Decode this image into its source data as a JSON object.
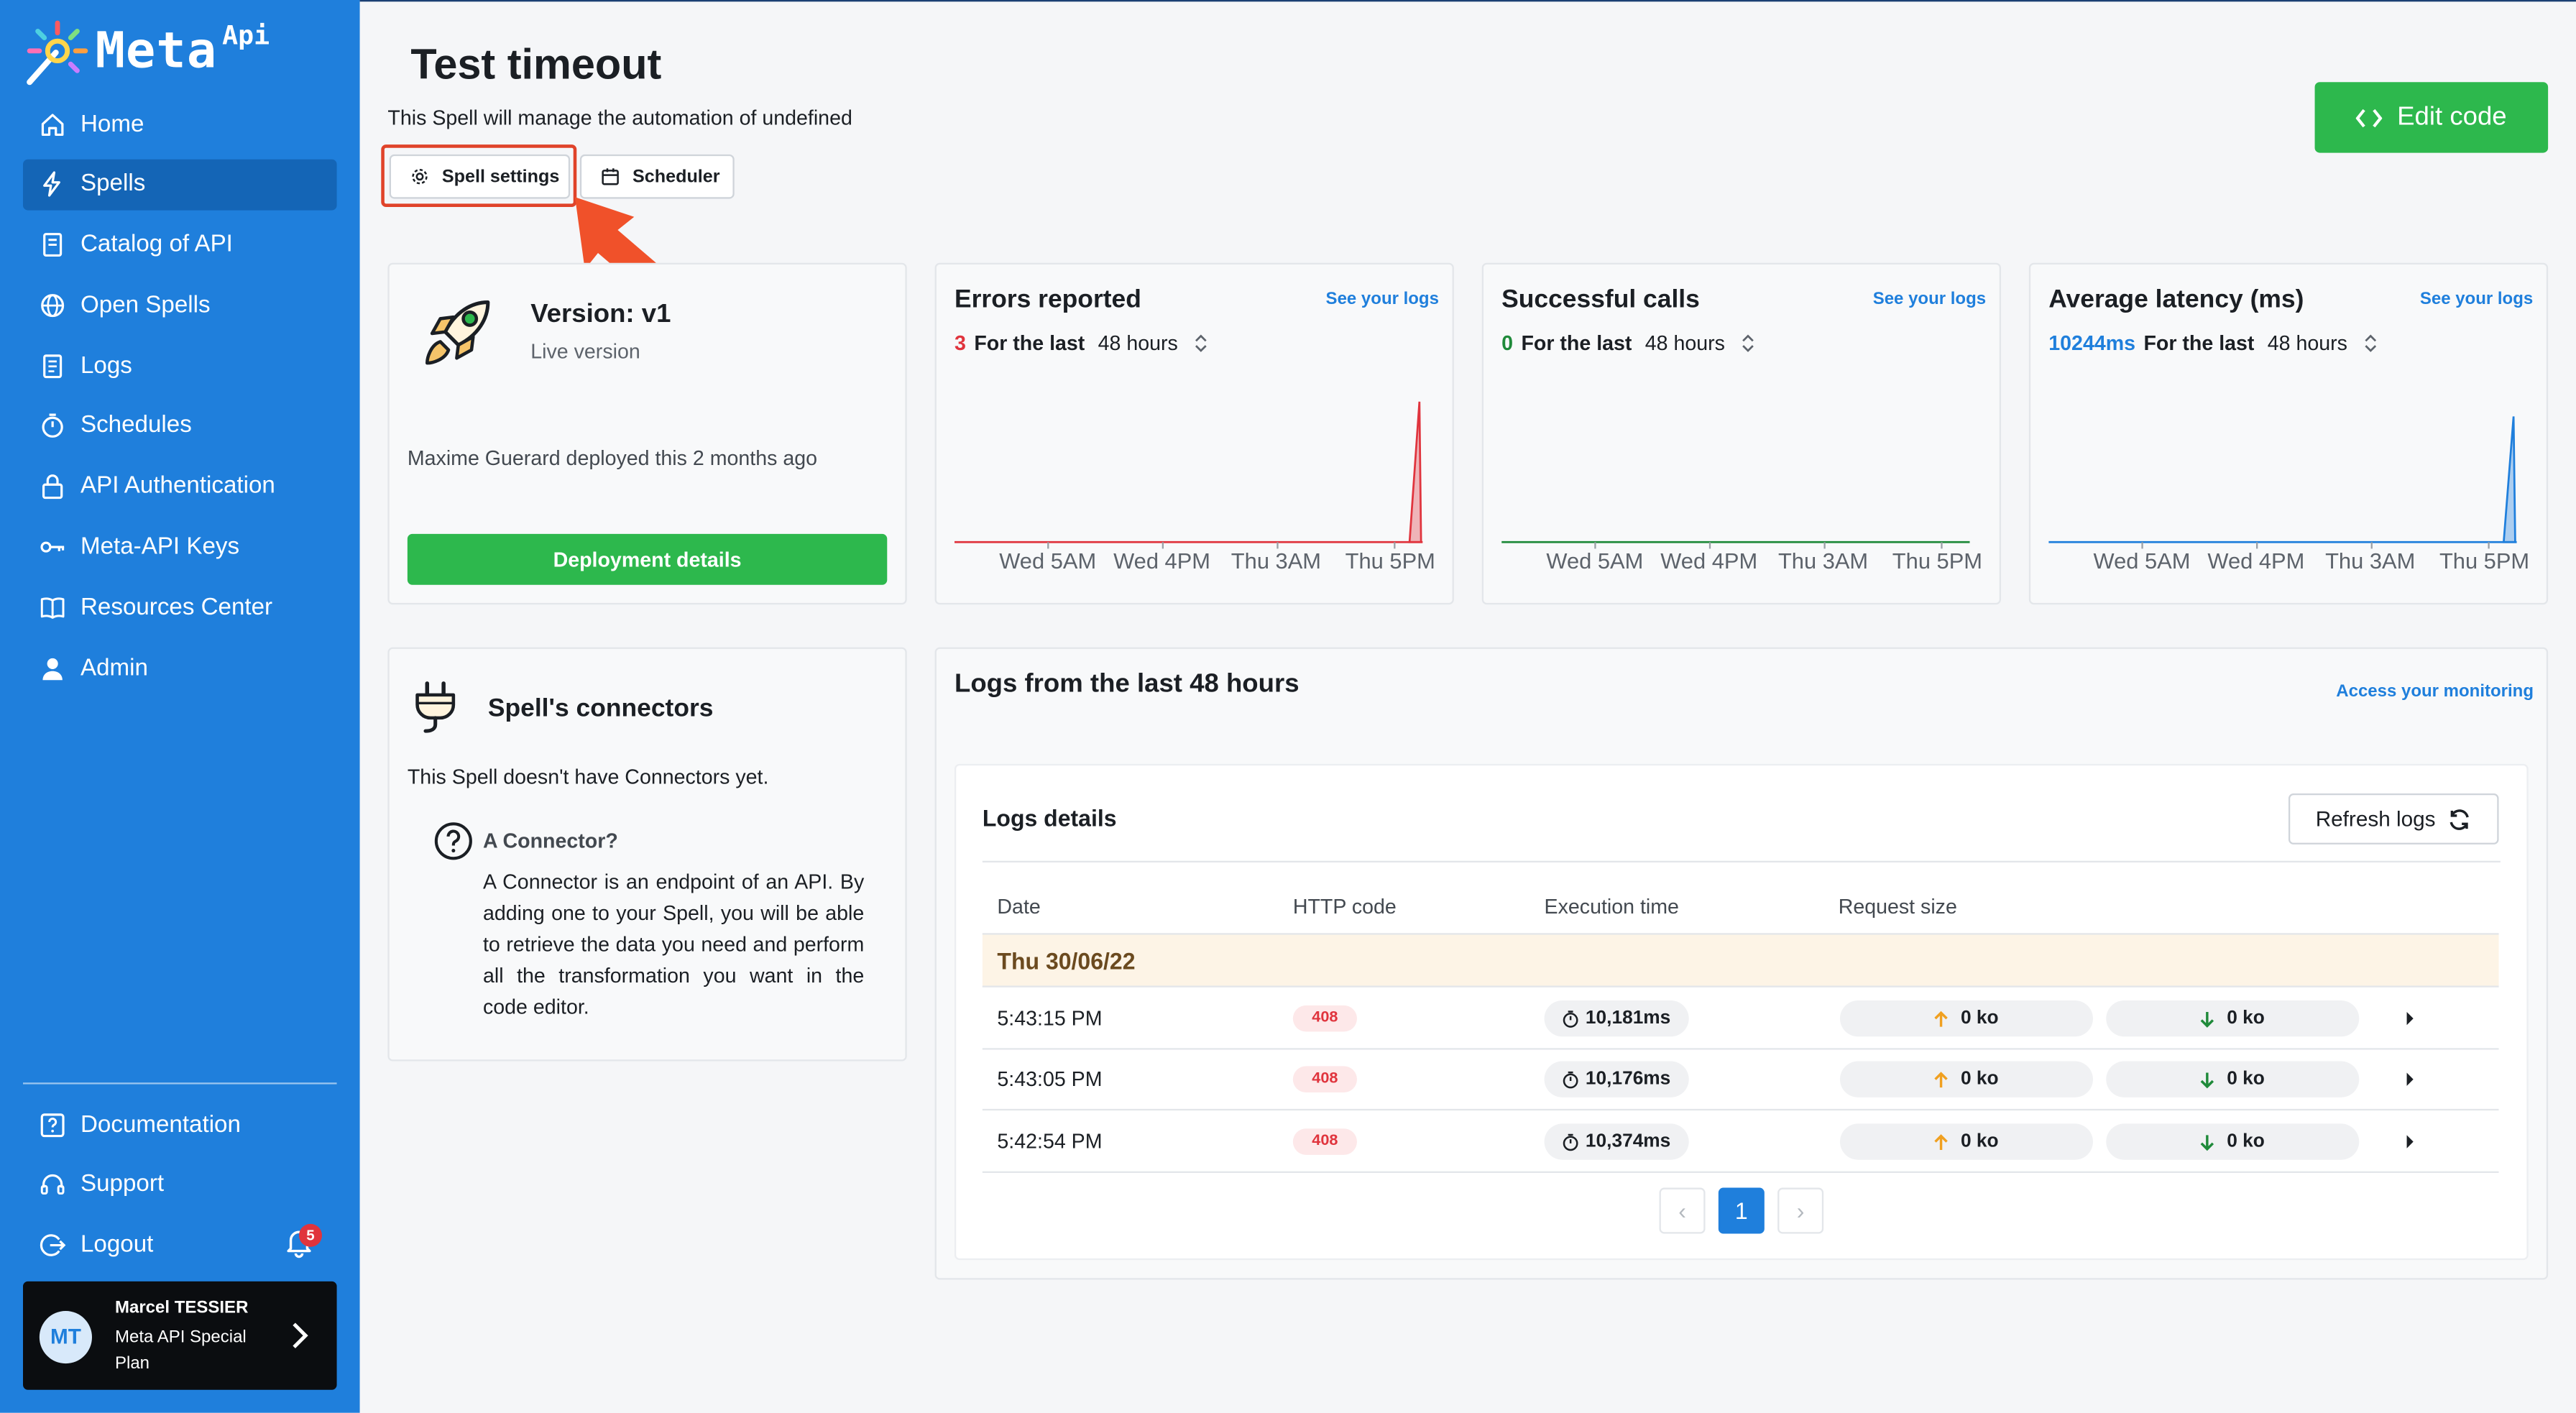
{
  "brand": {
    "name": "Meta",
    "sup": "Api"
  },
  "sidebar": {
    "items": [
      {
        "label": "Home",
        "icon": "home-icon"
      },
      {
        "label": "Spells",
        "icon": "bolt-icon",
        "active": true
      },
      {
        "label": "Catalog of API",
        "icon": "book-icon"
      },
      {
        "label": "Open Spells",
        "icon": "globe-icon"
      },
      {
        "label": "Logs",
        "icon": "document-icon"
      },
      {
        "label": "Schedules",
        "icon": "stopwatch-icon"
      },
      {
        "label": "API Authentication",
        "icon": "lock-icon"
      },
      {
        "label": "Meta-API Keys",
        "icon": "key-icon"
      },
      {
        "label": "Resources Center",
        "icon": "open-book-icon"
      },
      {
        "label": "Admin",
        "icon": "user-icon"
      }
    ],
    "bottom_items": [
      {
        "label": "Documentation",
        "icon": "help-box-icon"
      },
      {
        "label": "Support",
        "icon": "headset-icon"
      },
      {
        "label": "Logout",
        "icon": "logout-icon"
      }
    ],
    "notification_count": "5",
    "user": {
      "initials": "MT",
      "name": "Marcel TESSIER",
      "plan": "Meta API Special Plan"
    }
  },
  "header": {
    "title": "Test timeout",
    "subtitle": "This Spell will manage the automation of undefined",
    "tabs": [
      "Spell settings",
      "Scheduler"
    ],
    "edit_code": "Edit code"
  },
  "version_card": {
    "title": "Version: v1",
    "subtitle": "Live version",
    "deployed": "Maxime Guerard deployed this 2 months ago",
    "button": "Deployment details"
  },
  "metrics": [
    {
      "title": "Errors reported",
      "link": "See your logs",
      "count": "3",
      "count_color": "#e0343d",
      "for_label": "For the last",
      "period": "48 hours",
      "color": "#e0343d",
      "spike": 0.95
    },
    {
      "title": "Successful calls",
      "link": "See your logs",
      "count": "0",
      "count_color": "#1f8a3a",
      "for_label": "For the last",
      "period": "48 hours",
      "color": "#1f8a3a",
      "spike": 0
    },
    {
      "title": "Average latency (ms)",
      "link": "See your logs",
      "count": "10244ms",
      "count_color": "#1f7fdc",
      "for_label": "For the last",
      "period": "48 hours",
      "color": "#1f7fdc",
      "spike": 0.85
    }
  ],
  "axis_ticks": [
    "Wed 5AM",
    "Wed 4PM",
    "Thu 3AM",
    "Thu 5PM"
  ],
  "connectors": {
    "title": "Spell's connectors",
    "empty": "This Spell doesn't have Connectors yet.",
    "q_title": "A Connector?",
    "q_body": "A Connector is an endpoint of an API. By adding one to your Spell, you will be able to retrieve the data you need and perform all the transformation you want in the code editor."
  },
  "logs": {
    "title": "Logs from the last 48 hours",
    "access_link": "Access your monitoring",
    "details_title": "Logs details",
    "refresh": "Refresh logs",
    "columns": [
      "Date",
      "HTTP code",
      "Execution time",
      "Request size"
    ],
    "date_group": "Thu 30/06/22",
    "rows": [
      {
        "time": "5:43:15 PM",
        "code": "408",
        "exec": "10,181ms",
        "up": "0 ko",
        "down": "0 ko"
      },
      {
        "time": "5:43:05 PM",
        "code": "408",
        "exec": "10,176ms",
        "up": "0 ko",
        "down": "0 ko"
      },
      {
        "time": "5:42:54 PM",
        "code": "408",
        "exec": "10,374ms",
        "up": "0 ko",
        "down": "0 ko"
      }
    ],
    "pagination": {
      "prev": "‹",
      "current": "1",
      "next": "›"
    }
  }
}
